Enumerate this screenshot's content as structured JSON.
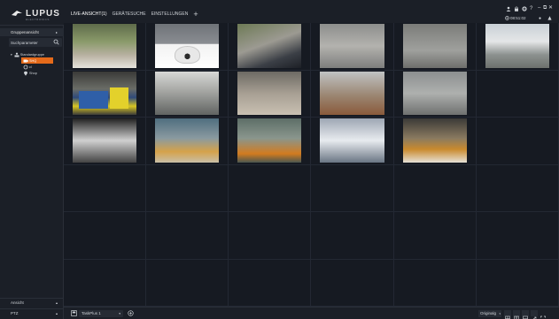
{
  "app": {
    "logo": "LUPUS",
    "logo_sub": "ELECTRONICS"
  },
  "nav": {
    "tabs": [
      {
        "label": "LIVE-ANSICHT(1)",
        "active": true
      },
      {
        "label": "GERÄTESUCHE",
        "active": false
      },
      {
        "label": "EINSTELLUNGEN",
        "active": false
      }
    ],
    "add_tab": "+"
  },
  "topright": {
    "icons": [
      "user-icon",
      "lock-icon",
      "gear-icon",
      "help-icon",
      "minimize-icon",
      "maximize-icon",
      "close-icon",
      "record-icon",
      "alarm-icon"
    ],
    "clock": "08:51:02"
  },
  "sidebar": {
    "header": "Gruppenansicht",
    "search_placeholder": "Suchparameter",
    "tree": {
      "root": "Standardgruppe",
      "children": [
        {
          "label": "SHQ",
          "selected": true
        },
        {
          "label": "cl",
          "selected": false
        },
        {
          "label": "Shop",
          "selected": false
        }
      ]
    },
    "bottom": [
      {
        "label": "Ansicht"
      },
      {
        "label": "PTZ"
      }
    ]
  },
  "grid": {
    "columns": 6,
    "rows": 6,
    "feeds": [
      {
        "cell": 0,
        "scene": "outdoor-trees"
      },
      {
        "cell": 1,
        "scene": "ptz-camera-product"
      },
      {
        "cell": 2,
        "scene": "parking-street"
      },
      {
        "cell": 3,
        "scene": "parking-lot-overhead"
      },
      {
        "cell": 4,
        "scene": "parking-cars"
      },
      {
        "cell": 5,
        "scene": "building-exterior"
      },
      {
        "cell": 6,
        "scene": "office-bins"
      },
      {
        "cell": 7,
        "scene": "street-fog"
      },
      {
        "cell": 8,
        "scene": "warehouse-floor"
      },
      {
        "cell": 9,
        "scene": "parking-entrance"
      },
      {
        "cell": 10,
        "scene": "parking-cars-2"
      },
      {
        "cell": 12,
        "scene": "server-room"
      },
      {
        "cell": 13,
        "scene": "warehouse-aisle"
      },
      {
        "cell": 14,
        "scene": "warehouse-topdown"
      },
      {
        "cell": 15,
        "scene": "office-corner"
      },
      {
        "cell": 16,
        "scene": "warehouse-shelves"
      }
    ]
  },
  "bottombar": {
    "layout_name": "TaskPlus 1",
    "stream": "Originalg",
    "buttons": [
      "grid-1-icon",
      "grid-4-icon",
      "grid-9-icon",
      "fullscreen-icon",
      "expand-icon"
    ]
  }
}
